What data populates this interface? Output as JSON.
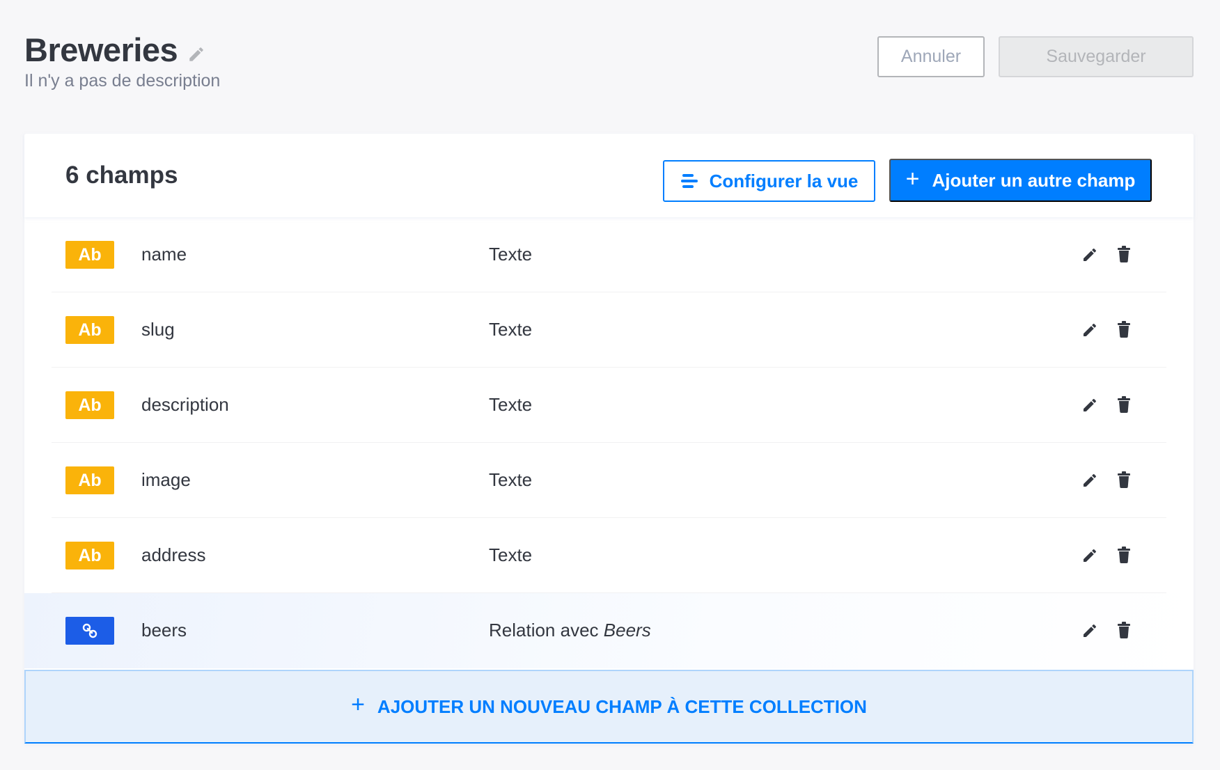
{
  "header": {
    "title": "Breweries",
    "description": "Il n'y a pas de description",
    "cancel_label": "Annuler",
    "save_label": "Sauvegarder"
  },
  "card": {
    "fields_count": "6 champs",
    "configure_label": "Configurer la vue",
    "add_field_label": "Ajouter un autre champ",
    "add_field_plus": "+"
  },
  "fields": [
    {
      "badge": "Ab",
      "name": "name",
      "type": "Texte"
    },
    {
      "badge": "Ab",
      "name": "slug",
      "type": "Texte"
    },
    {
      "badge": "Ab",
      "name": "description",
      "type": "Texte"
    },
    {
      "badge": "Ab",
      "name": "image",
      "type": "Texte"
    },
    {
      "badge": "Ab",
      "name": "address",
      "type": "Texte"
    },
    {
      "badge_icon": "link-icon",
      "name": "beers",
      "type_prefix": "Relation avec",
      "type_target": "Beers"
    }
  ],
  "add_new_bar": {
    "plus": "+",
    "label": "AJOUTER UN NOUVEAU CHAMP À CETTE COLLECTION"
  },
  "colors": {
    "accent": "#007eff",
    "text_badge": "#fab30a",
    "relation_badge": "#1c5de7"
  },
  "icons": {
    "title_edit": "pencil-icon",
    "configure": "sliders-icon",
    "row_edit": "pencil-icon",
    "row_delete": "trash-icon"
  }
}
